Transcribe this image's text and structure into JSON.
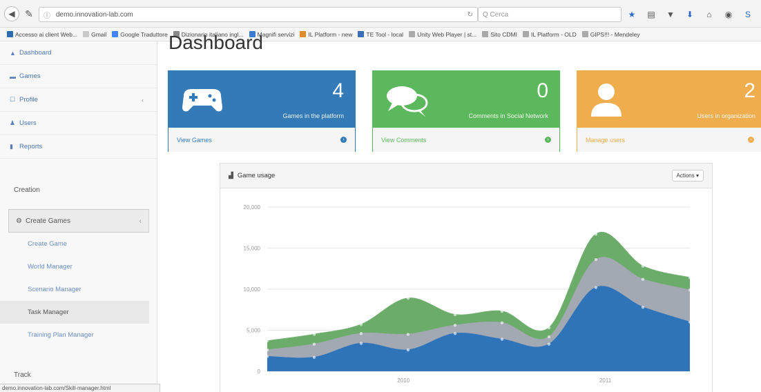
{
  "browser": {
    "url": "demo.innovation-lab.com",
    "search_placeholder": "Q Cerca",
    "bookmarks": [
      {
        "label": "Accesso ai client Web...",
        "color": "#2b6cb0"
      },
      {
        "label": "Gmail",
        "color": "#c9c9c9"
      },
      {
        "label": "Google Traduttore",
        "color": "#4285f4"
      },
      {
        "label": "Dizionario italiano ingl...",
        "color": "#888888"
      },
      {
        "label": "Magnifi servizi",
        "color": "#3b7bd0"
      },
      {
        "label": "IL Platform - new",
        "color": "#e08a2c"
      },
      {
        "label": "TE Tool - local",
        "color": "#3a6fb8"
      },
      {
        "label": "Unity Web Player | st...",
        "color": "#aaaaaa"
      },
      {
        "label": "Sito CDMI",
        "color": "#aaaaaa"
      },
      {
        "label": "IL Platform - OLD",
        "color": "#aaaaaa"
      },
      {
        "label": "GIPS!!! - Mendeley",
        "color": "#aaaaaa"
      }
    ],
    "status_text": "demo.innovation-lab.com/Skill-manager.html"
  },
  "sidebar": {
    "items": [
      {
        "label": "Dashboard",
        "icon": "dashboard-icon",
        "glyph": "▲"
      },
      {
        "label": "Games",
        "icon": "games-icon",
        "glyph": "▬"
      },
      {
        "label": "Profile",
        "icon": "profile-icon",
        "glyph": "☐",
        "chevron": "‹"
      },
      {
        "label": "Users",
        "icon": "user-icon",
        "glyph": "♟"
      },
      {
        "label": "Reports",
        "icon": "reports-icon",
        "glyph": "▮"
      }
    ],
    "section_creation": "Creation",
    "create_games": {
      "label": "Create Games",
      "glyph": "⚙",
      "chevron": "‹"
    },
    "sub_items": [
      {
        "label": "Create Game",
        "active": false
      },
      {
        "label": "World Manager",
        "active": false
      },
      {
        "label": "Scenario Manager",
        "active": false
      },
      {
        "label": "Task Manager",
        "active": true
      },
      {
        "label": "Training Plan Manager",
        "active": false
      }
    ],
    "section_track": "Track"
  },
  "page": {
    "title": "Dashboard"
  },
  "cards": [
    {
      "value": "4",
      "label": "Games in the platform",
      "link": "View Games",
      "color": "#337ab7",
      "icon": "gamepad-icon"
    },
    {
      "value": "0",
      "label": "Comments in Social Network",
      "link": "View Comments",
      "color": "#5cb85c",
      "icon": "comments-icon"
    },
    {
      "value": "2",
      "label": "Users in organization",
      "link": "Manage users",
      "color": "#f0ad4e",
      "icon": "user-icon"
    }
  ],
  "chart_panel": {
    "title": "Game usage",
    "actions_label": "Actions ▾"
  },
  "chart_data": {
    "type": "area",
    "stacked": true,
    "x": [
      0,
      1,
      2,
      3,
      4,
      5,
      6,
      7,
      8,
      9
    ],
    "xtick_labels": [
      "2010",
      "2011"
    ],
    "yticks": [
      "0",
      "5,000",
      "10,000",
      "15,000",
      "20,000"
    ],
    "ylim": [
      0,
      20000
    ],
    "series": [
      {
        "values": [
          1800,
          1700,
          3400,
          2600,
          4600,
          3900,
          3300,
          10200,
          7800,
          6000
        ],
        "color": "#2f73b9"
      },
      {
        "values": [
          800,
          1600,
          1200,
          1900,
          1000,
          2000,
          900,
          3400,
          3400,
          3900
        ],
        "color": "#a3a9b3"
      },
      {
        "values": [
          1100,
          1200,
          1100,
          4400,
          1300,
          1400,
          1100,
          3100,
          1600,
          1500
        ],
        "color": "#6bac6a"
      }
    ],
    "grid": true
  }
}
